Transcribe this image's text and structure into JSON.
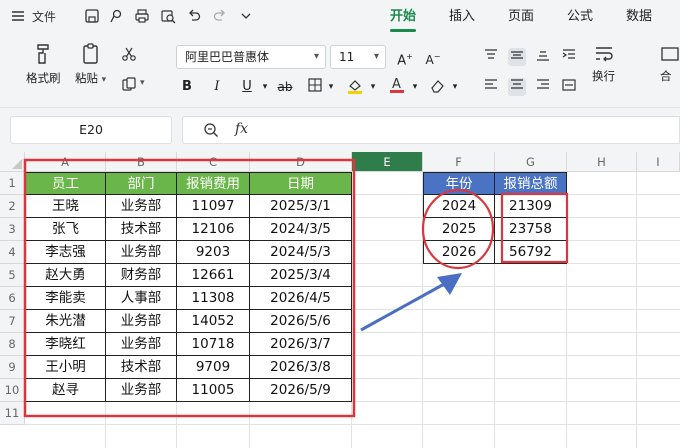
{
  "titlebar": {
    "menu_label": "文件",
    "tabs": [
      "开始",
      "插入",
      "页面",
      "公式",
      "数据"
    ],
    "active_tab": "开始"
  },
  "ribbon": {
    "format_painter": "格式刷",
    "paste": "粘贴",
    "font_name": "阿里巴巴普惠体",
    "font_size": "11",
    "wrap": "换行",
    "merge": "合"
  },
  "formula_bar": {
    "name_box": "E20",
    "fx_label": "fx",
    "formula": ""
  },
  "columns": [
    "A",
    "B",
    "C",
    "D",
    "E",
    "F",
    "G",
    "H",
    "I"
  ],
  "selected_column": "E",
  "rows": [
    "1",
    "2",
    "3",
    "4",
    "5",
    "6",
    "7",
    "8",
    "9",
    "10",
    "11"
  ],
  "table_left": {
    "headers": [
      "员工",
      "部门",
      "报销费用",
      "日期"
    ],
    "rows": [
      [
        "王晓",
        "业务部",
        "11097",
        "2025/3/1"
      ],
      [
        "张飞",
        "技术部",
        "12106",
        "2024/3/5"
      ],
      [
        "李志强",
        "业务部",
        "9203",
        "2024/5/3"
      ],
      [
        "赵大勇",
        "财务部",
        "12661",
        "2025/3/4"
      ],
      [
        "李能卖",
        "人事部",
        "11308",
        "2026/4/5"
      ],
      [
        "朱光潜",
        "业务部",
        "14052",
        "2026/5/6"
      ],
      [
        "李晓红",
        "业务部",
        "10718",
        "2026/3/7"
      ],
      [
        "王小明",
        "技术部",
        "9709",
        "2026/3/8"
      ],
      [
        "赵寻",
        "业务部",
        "11005",
        "2026/5/9"
      ]
    ]
  },
  "table_right": {
    "headers": [
      "年份",
      "报销总额"
    ],
    "rows": [
      [
        "2024",
        "21309"
      ],
      [
        "2025",
        "23758"
      ],
      [
        "2026",
        "56792"
      ]
    ]
  },
  "colors": {
    "accent_green": "#1a8a4a",
    "header_green": "#6ab64a",
    "header_blue": "#4a73c4",
    "annotation_red": "#d9363e",
    "arrow_blue": "#4a6fc2"
  }
}
